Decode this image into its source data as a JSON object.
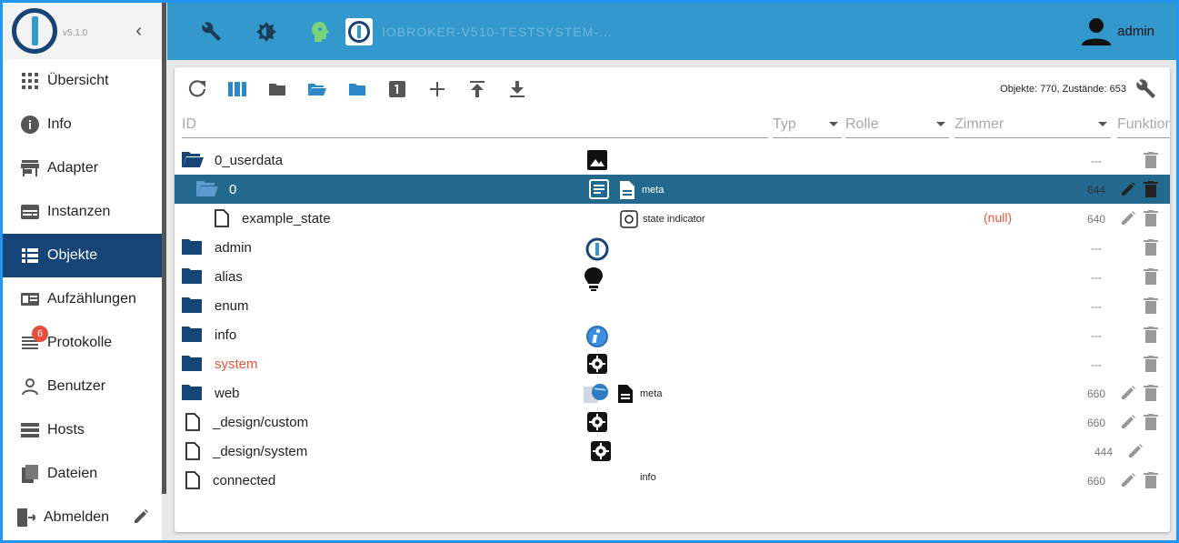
{
  "sidebar": {
    "version": "v5.1.0",
    "items": [
      {
        "label": "Übersicht",
        "icon": "apps-grid-icon"
      },
      {
        "label": "Info",
        "icon": "info-circle-icon"
      },
      {
        "label": "Adapter",
        "icon": "store-icon"
      },
      {
        "label": "Instanzen",
        "icon": "instances-icon"
      },
      {
        "label": "Objekte",
        "icon": "list-icon",
        "active": true
      },
      {
        "label": "Aufzählungen",
        "icon": "enum-icon"
      },
      {
        "label": "Protokolle",
        "icon": "log-icon",
        "badge": "6"
      },
      {
        "label": "Benutzer",
        "icon": "user-icon"
      },
      {
        "label": "Hosts",
        "icon": "hosts-icon"
      },
      {
        "label": "Dateien",
        "icon": "files-icon"
      },
      {
        "label": "Abmelden",
        "icon": "logout-icon"
      }
    ]
  },
  "header": {
    "host_name": "IOBROKER-V510-TESTSYSTEM-...",
    "user": "admin"
  },
  "toolbar": {
    "counts": "Objekte: 770, Zustände: 653"
  },
  "filters": {
    "id": "ID",
    "type": "Typ",
    "role": "Rolle",
    "room": "Zimmer",
    "function": "Funktion"
  },
  "rows": [
    {
      "name": "0_userdata",
      "acl": "---"
    },
    {
      "name": "0",
      "role": "meta",
      "acl": "644"
    },
    {
      "name": "example_state",
      "role": "state indicator",
      "value": "(null)",
      "acl": "640"
    },
    {
      "name": "admin",
      "acl": "---"
    },
    {
      "name": "alias",
      "acl": "---"
    },
    {
      "name": "enum",
      "acl": "---"
    },
    {
      "name": "info",
      "acl": "---"
    },
    {
      "name": "system",
      "acl": "---"
    },
    {
      "name": "web",
      "role": "meta",
      "acl": "660"
    },
    {
      "name": "_design/custom",
      "acl": "660"
    },
    {
      "name": "_design/system",
      "acl": "444"
    },
    {
      "name": "connected",
      "role": "info",
      "acl": "660"
    }
  ],
  "colors": {
    "primary": "#164477",
    "appbar": "#3399cc",
    "selected_row": "#23698e",
    "accent_red": "#e0583a"
  }
}
